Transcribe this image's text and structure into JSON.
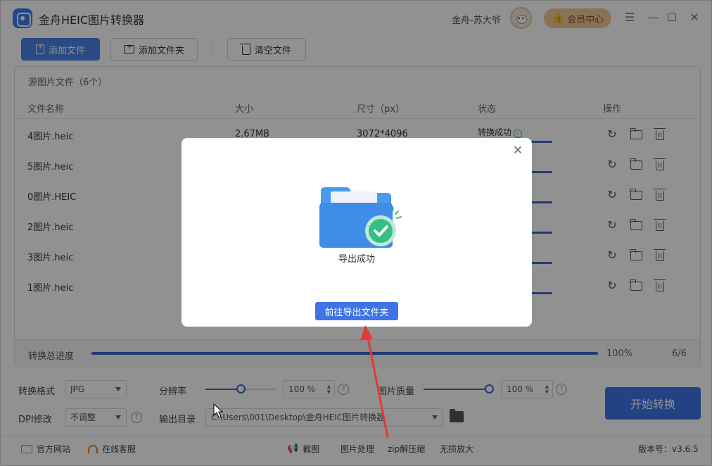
{
  "app": {
    "title": "金舟HEIC图片转换器",
    "user_name": "金舟-苏大爷",
    "vip_label": "会员中心"
  },
  "toolbar": {
    "add_file": "添加文件",
    "add_folder": "添加文件夹",
    "clear_files": "清空文件"
  },
  "panel": {
    "title": "源图片文件（6个）",
    "columns": [
      "文件名称",
      "大小",
      "尺寸（px）",
      "状态",
      "操作"
    ],
    "rows": [
      {
        "name": "4图片.heic",
        "size": "2.67MB",
        "dims": "3072*4096",
        "status": "转换成功"
      },
      {
        "name": "5图片.heic",
        "size": "",
        "dims": "",
        "status": ""
      },
      {
        "name": "0图片.HEIC",
        "size": "",
        "dims": "",
        "status": ""
      },
      {
        "name": "2图片.heic",
        "size": "",
        "dims": "",
        "status": ""
      },
      {
        "name": "3图片.heic",
        "size": "",
        "dims": "",
        "status": ""
      },
      {
        "name": "1图片.heic",
        "size": "",
        "dims": "",
        "status": ""
      }
    ],
    "progress_label": "转换总进度",
    "progress_value": 1.0,
    "progress_text": "100%",
    "progress_count": "6/6"
  },
  "settings": {
    "format_label": "转换格式",
    "format_value": "JPG",
    "resolution_label": "分辨率",
    "resolution_value": "100",
    "resolution_unit": "%",
    "resolution_level": 0.5,
    "quality_label": "图片质量",
    "quality_value": "100",
    "quality_unit": "%",
    "quality_level": 1.0,
    "dpi_label": "DPI修改",
    "dpi_value": "不调整",
    "output_label": "输出目录",
    "output_path": "C:\\Users\\001\\Desktop\\金舟HEIC图片转换器",
    "start_label": "开始转换"
  },
  "footer": {
    "website": "官方网站",
    "support": "在线客服",
    "screenshot": "截图",
    "image_process": "图片处理",
    "zip": "zip解压缩",
    "upscale": "无损放大",
    "version": "版本号：v3.6.5"
  },
  "dialog": {
    "message": "导出成功",
    "open_folder": "前往导出文件夹"
  },
  "colors": {
    "accent": "#3e74e6",
    "progress": "#3f66c8",
    "success": "#3cb371",
    "annotation": "#e53935"
  }
}
